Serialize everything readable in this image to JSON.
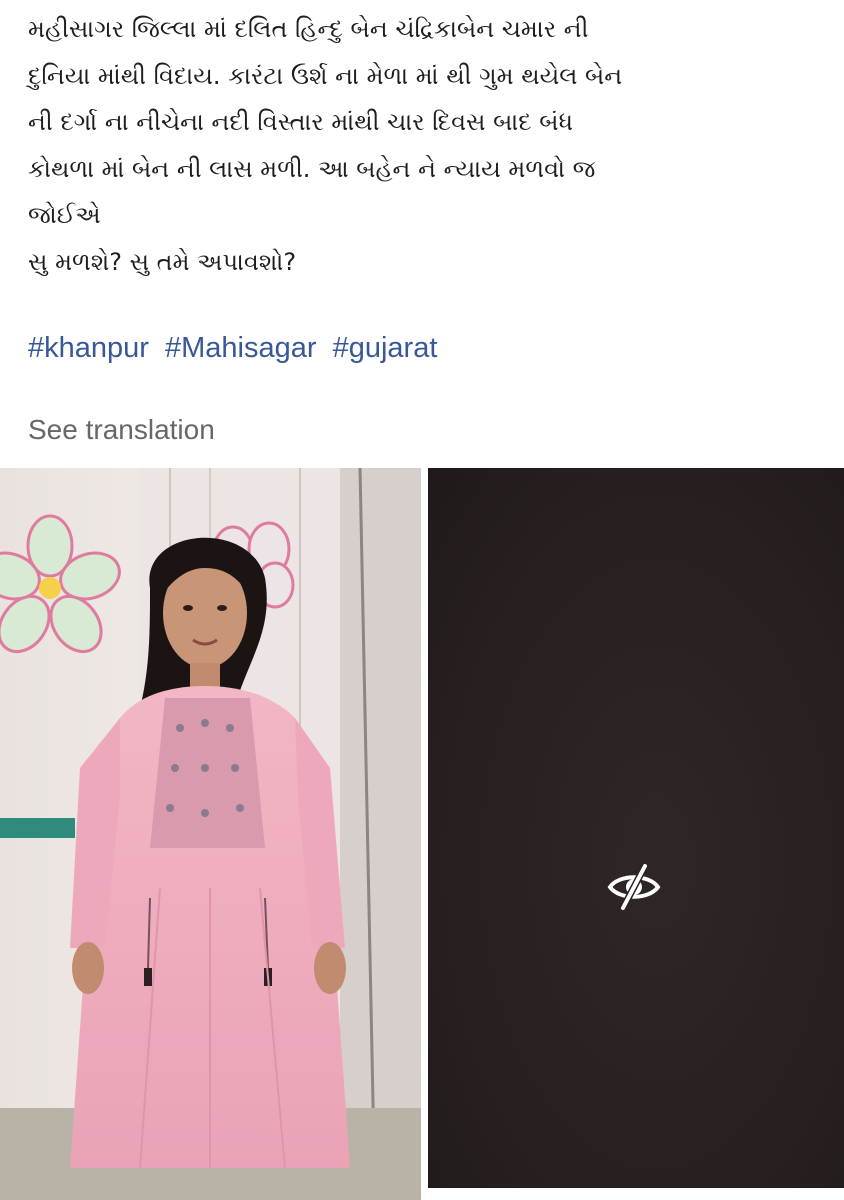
{
  "post": {
    "text_lines": [
      "મહીસાગર જિલ્લા માં દલિત હિન્દુ બેન ચંદ્રિકાબેન ચમાર ની",
      "દુનિયા માંથી વિદાય. કારંટા ઉર્શ ના મેળા માં થી ગુમ થયેલ બેન",
      "ની દર્ગા ના નીચેના નદી વિસ્તાર માંથી ચાર દિવસ બાદ બંધ",
      "કોથળા માં બેન ની લાસ મળી. આ બહેન ને ન્યાય મળવો જ",
      "જોઈએ",
      "સુ મળશે? સુ તમે અપાવશો?"
    ],
    "hashtags": [
      "#khanpur",
      "#Mahisagar",
      "#gujarat"
    ],
    "see_translation": "See translation"
  },
  "media": {
    "right_overlay_icon": "eye-slash-icon",
    "colors": {
      "hashtag": "#385898",
      "secondary_text": "#65676b",
      "dark_panel": "#2b2222"
    }
  }
}
